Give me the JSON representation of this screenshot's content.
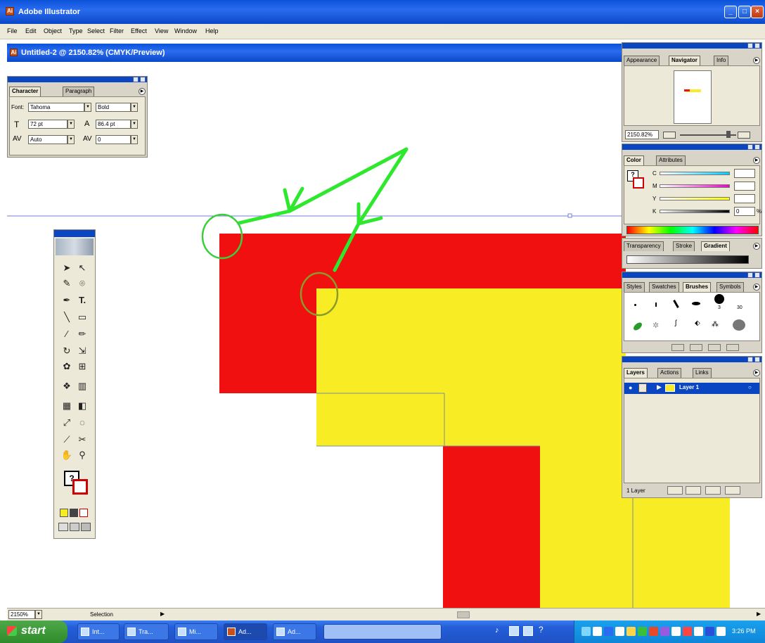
{
  "app": {
    "title": "Adobe Illustrator"
  },
  "menu": [
    "File",
    "Edit",
    "Object",
    "Type",
    "Select",
    "Filter",
    "Effect",
    "View",
    "Window",
    "Help"
  ],
  "document": {
    "title": "Untitled-2 @ 2150.82% (CMYK/Preview)"
  },
  "character_palette": {
    "tabs": [
      "Character",
      "Paragraph"
    ],
    "font_label": "Font:",
    "font_value": "Tahoma",
    "style_value": "Bold",
    "size_value": "72 pt",
    "leading_value": "86.4 pt",
    "kerning_value": "Auto",
    "tracking_value": "0"
  },
  "navigator_palette": {
    "tabs": [
      "Appearance",
      "Navigator",
      "Info"
    ],
    "zoom_value": "2150.82%"
  },
  "color_palette": {
    "tabs": [
      "Color",
      "Attributes"
    ],
    "channels": [
      "C",
      "M",
      "Y",
      "K"
    ],
    "k_value": "0",
    "percent": "%"
  },
  "gradient_palette": {
    "tabs": [
      "Transparency",
      "Stroke",
      "Gradient"
    ]
  },
  "brushes_palette": {
    "tabs": [
      "Styles",
      "Swatches",
      "Brushes",
      "Symbols"
    ],
    "brush_size_labels": [
      "3",
      "30"
    ]
  },
  "layers_palette": {
    "tabs": [
      "Layers",
      "Actions",
      "Links"
    ],
    "layer_name": "Layer 1",
    "footer_label": "1 Layer"
  },
  "status": {
    "zoom": "2150%",
    "tool": "Selection"
  },
  "taskbar": {
    "start_label": "start",
    "tasks": [
      "Int...",
      "Tra...",
      "Mi...",
      "Ad...",
      "Ad..."
    ],
    "clock": "3:26 PM"
  },
  "colors": {
    "red": "#f01010",
    "yellow": "#f8ec24",
    "guide": "#6f7fd8",
    "annotation": "#2ee82e",
    "circle_1": "#3ccf3c",
    "circle_2": "#8c9a2a"
  }
}
